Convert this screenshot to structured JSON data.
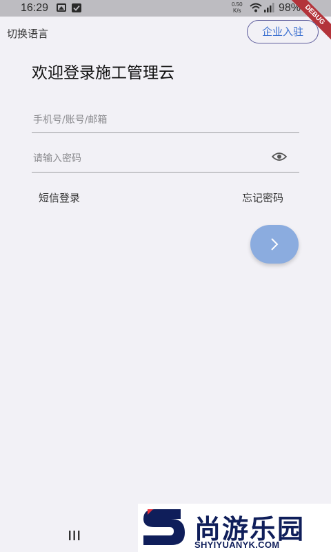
{
  "status_bar": {
    "time": "16:29",
    "network_speed_value": "0.50",
    "network_speed_unit": "K/s",
    "battery": "98%",
    "icons": [
      "image-icon",
      "check-icon",
      "wifi-icon",
      "signal-icon"
    ]
  },
  "debug_banner": "DEBUG",
  "header": {
    "language_switch": "切换语言",
    "enterprise_join": "企业入驻"
  },
  "page_title": "欢迎登录施工管理云",
  "form": {
    "account_placeholder": "手机号/账号/邮箱",
    "password_placeholder": "请输入密码",
    "sms_login": "短信登录",
    "forgot_password": "忘记密码"
  },
  "colors": {
    "background": "#f2f1f6",
    "next_button": "#8bacdf",
    "enterprise_text": "#3a6fd0",
    "enterprise_border": "#5b5a9a"
  },
  "watermark": {
    "name": "尚游乐园",
    "domain": "SHYIYUANYK.COM"
  }
}
